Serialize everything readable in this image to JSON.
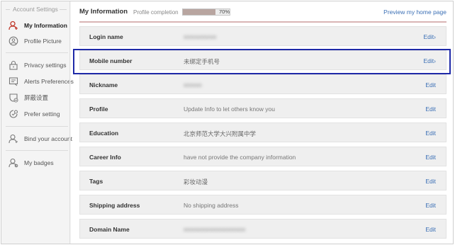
{
  "sidebar": {
    "section_title": "Account Settings",
    "items": [
      {
        "label": "My Information",
        "icon": "user-icon"
      },
      {
        "label": "Profile Picture",
        "icon": "profile-picture-icon"
      },
      {
        "label": "Privacy settings",
        "icon": "lock-icon"
      },
      {
        "label": "Alerts Preferences",
        "icon": "message-icon"
      },
      {
        "label": "屏蔽设置",
        "icon": "block-icon"
      },
      {
        "label": "Prefer setting",
        "icon": "prefer-icon"
      },
      {
        "label": "Bind your account",
        "icon": "bind-user-icon"
      },
      {
        "label": "My badges",
        "icon": "badge-user-icon"
      }
    ]
  },
  "header": {
    "title": "My Information",
    "completion_label": "Profile completion",
    "completion_value": "70%",
    "completion_fraction": 0.7,
    "preview_link": "Preview my home page"
  },
  "rows": [
    {
      "label": "Login name",
      "value": "■■■■■■■■■",
      "edit": "Edit›",
      "blurred": true
    },
    {
      "label": "Mobile number",
      "value": "未绑定手机号",
      "edit": "Edit›"
    },
    {
      "label": "Nickname",
      "value": "■■■■■",
      "edit": "Edit",
      "blurred": true
    },
    {
      "label": "Profile",
      "value": "Update Info to let others know you",
      "edit": "Edit"
    },
    {
      "label": "Education",
      "value": "北京师范大学大兴附属中学",
      "edit": "Edit"
    },
    {
      "label": "Career Info",
      "value": "have not provide the company information",
      "edit": "Edit"
    },
    {
      "label": "Tags",
      "value": "彩妆动漫",
      "edit": "Edit"
    },
    {
      "label": "Shipping address",
      "value": "No shipping address",
      "edit": "Edit"
    },
    {
      "label": "Domain Name",
      "value": "■■■■■■■■■■■■■■■■■",
      "edit": "Edit",
      "blurred": true
    }
  ],
  "colors": {
    "accent_link": "#3b6fb5",
    "highlight_border": "#1f2aa8",
    "active_icon": "#c0392b"
  }
}
